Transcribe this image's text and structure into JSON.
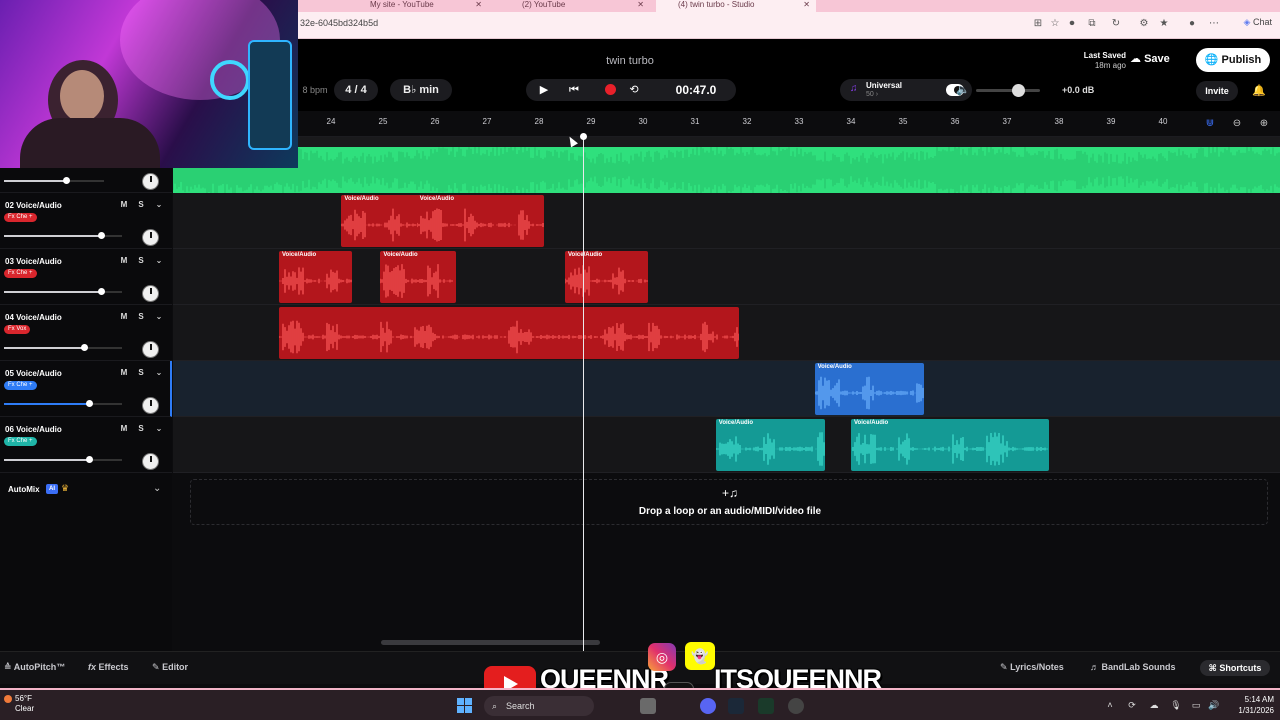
{
  "browser": {
    "tabs": [
      {
        "label": "My site - YouTube"
      },
      {
        "label": "(2) YouTube"
      },
      {
        "label": "(4) twin turbo - Studio"
      }
    ],
    "url": "32e-6045bd324b5d",
    "chat_label": "Chat"
  },
  "header": {
    "project_title": "twin turbo",
    "bpm_label": "8 bpm",
    "time_signature": "4 / 4",
    "key": "B♭ min",
    "time": "00:47.0",
    "tuner_label": "Universal",
    "tuner_sub": "50 ›",
    "volume_db": "+0.0 dB",
    "last_saved_label": "Last Saved",
    "last_saved_value": "18m ago",
    "save_label": "Save",
    "publish_label": "Publish",
    "invite_label": "Invite"
  },
  "ruler": {
    "bars": [
      "24",
      "25",
      "26",
      "27",
      "28",
      "29",
      "30",
      "31",
      "32",
      "33",
      "34",
      "35",
      "36",
      "37",
      "38",
      "39",
      "40"
    ]
  },
  "tracks": [
    {
      "name": "",
      "fx": "",
      "fx_color": "",
      "volume": 0.62
    },
    {
      "name": "02 Voice/Audio",
      "fx": "Fx Che +",
      "fx_color": "#d9262d",
      "volume": 0.82,
      "clips": [
        {
          "label": "Voice/Audio",
          "start": 24.2,
          "end": 26.7
        },
        {
          "label": "Voice/Audio",
          "start": 25.65,
          "end": 28.1
        }
      ]
    },
    {
      "name": "03 Voice/Audio",
      "fx": "Fx Che +",
      "fx_color": "#d9262d",
      "volume": 0.82,
      "clips": [
        {
          "label": "Voice/Audio",
          "start": 23.0,
          "end": 24.4
        },
        {
          "label": "Voice/Audio",
          "start": 24.95,
          "end": 26.4
        },
        {
          "label": "Voice/Audio",
          "start": 28.5,
          "end": 30.1
        }
      ]
    },
    {
      "name": "04 Voice/Audio",
      "fx": "Fx Vox",
      "fx_color": "#d9262d",
      "volume": 0.68,
      "clips": [
        {
          "label": "",
          "start": 23.0,
          "end": 31.85
        }
      ]
    },
    {
      "name": "05 Voice/Audio",
      "fx": "Fx Che +",
      "fx_color": "#2e7cf6",
      "volume": 0.72,
      "clips": [
        {
          "label": "Voice/Audio",
          "start": 33.3,
          "end": 35.4
        }
      ]
    },
    {
      "name": "06 Voice/Audio",
      "fx": "Fx Che +",
      "fx_color": "#1fb5a8",
      "volume": 0.72,
      "clips": [
        {
          "label": "Voice/Audio",
          "start": 31.4,
          "end": 33.5
        },
        {
          "label": "Voice/Audio",
          "start": 34.0,
          "end": 37.8
        }
      ]
    }
  ],
  "automix": {
    "label": "AutoMix",
    "badge": "AI"
  },
  "dropzone": {
    "text": "Drop a loop or an audio/MIDI/video file"
  },
  "bottom": {
    "autopitch": "AutoPitch™",
    "effects": "Effects",
    "editor": "Editor",
    "lyrics": "Lyrics/Notes",
    "sounds": "BandLab Sounds",
    "shortcuts": "Shortcuts"
  },
  "social": {
    "handle_left": "QUEENNR",
    "handle_right": "ITSQUEENNR"
  },
  "taskbar": {
    "temp": "56°F",
    "condition": "Clear",
    "search": "Search",
    "time": "5:14 AM",
    "date": "1/31/2026"
  },
  "colors": {
    "accent_green": "#2fe07d",
    "red_clip": "#b3161c",
    "blue_clip": "#2a6fd0",
    "teal_clip": "#149a95"
  },
  "playhead_bar": 29.0
}
